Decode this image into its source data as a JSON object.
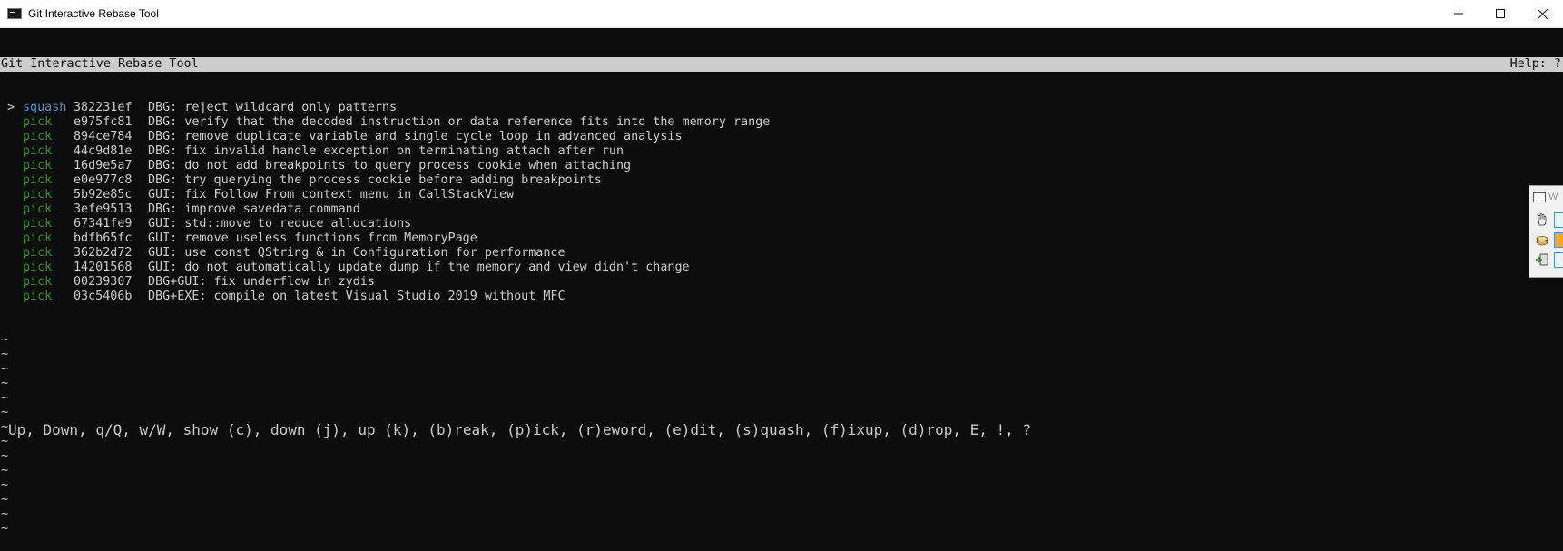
{
  "window": {
    "title": "Git Interactive Rebase Tool",
    "controls": [
      "minimize",
      "maximize",
      "close"
    ]
  },
  "header": {
    "title": "Git Interactive Rebase Tool",
    "help": "Help: ?"
  },
  "commits": [
    {
      "selected": true,
      "action": "squash",
      "hash": "382231ef",
      "message": "DBG: reject wildcard only patterns"
    },
    {
      "selected": false,
      "action": "pick",
      "hash": "e975fc81",
      "message": "DBG: verify that the decoded instruction or data reference fits into the memory range"
    },
    {
      "selected": false,
      "action": "pick",
      "hash": "894ce784",
      "message": "DBG: remove duplicate variable and single cycle loop in advanced analysis"
    },
    {
      "selected": false,
      "action": "pick",
      "hash": "44c9d81e",
      "message": "DBG: fix invalid handle exception on terminating attach after run"
    },
    {
      "selected": false,
      "action": "pick",
      "hash": "16d9e5a7",
      "message": "DBG: do not add breakpoints to query process cookie when attaching"
    },
    {
      "selected": false,
      "action": "pick",
      "hash": "e0e977c8",
      "message": "DBG: try querying the process cookie before adding breakpoints"
    },
    {
      "selected": false,
      "action": "pick",
      "hash": "5b92e85c",
      "message": "GUI: fix Follow From context menu in CallStackView"
    },
    {
      "selected": false,
      "action": "pick",
      "hash": "3efe9513",
      "message": "DBG: improve savedata command"
    },
    {
      "selected": false,
      "action": "pick",
      "hash": "67341fe9",
      "message": "GUI: std::move to reduce allocations"
    },
    {
      "selected": false,
      "action": "pick",
      "hash": "bdfb65fc",
      "message": "GUI: remove useless functions from MemoryPage"
    },
    {
      "selected": false,
      "action": "pick",
      "hash": "362b2d72",
      "message": "GUI: use const QString & in Configuration for performance"
    },
    {
      "selected": false,
      "action": "pick",
      "hash": "14201568",
      "message": "GUI: do not automatically update dump if the memory and view didn't change"
    },
    {
      "selected": false,
      "action": "pick",
      "hash": "00239307",
      "message": "DBG+GUI: fix underflow in zydis"
    },
    {
      "selected": false,
      "action": "pick",
      "hash": "03c5406b",
      "message": "DBG+EXE: compile on latest Visual Studio 2019 without MFC"
    }
  ],
  "marker": ">",
  "empty_line_glyph": "~",
  "empty_lines": 14,
  "footer": {
    "help_line": "Up, Down, q/Q, w/W, show (c), down (j), up (k), (b)reak, (p)ick, (r)eword, (e)dit, (s)quash, (f)ixup, (d)rop, E, !, ?"
  },
  "background_window": {
    "title_fragment": "W",
    "swatch_colors": [
      "#e8f2fb",
      "#f7a51c",
      "#e8f2fb"
    ],
    "icons": [
      "hand-icon",
      "cup-icon",
      "exit-icon"
    ]
  },
  "colors": {
    "pick": "#13a10e",
    "squash": "#3a96dd",
    "terminal_bg": "#0c0c0c",
    "terminal_fg": "#cccccc"
  }
}
